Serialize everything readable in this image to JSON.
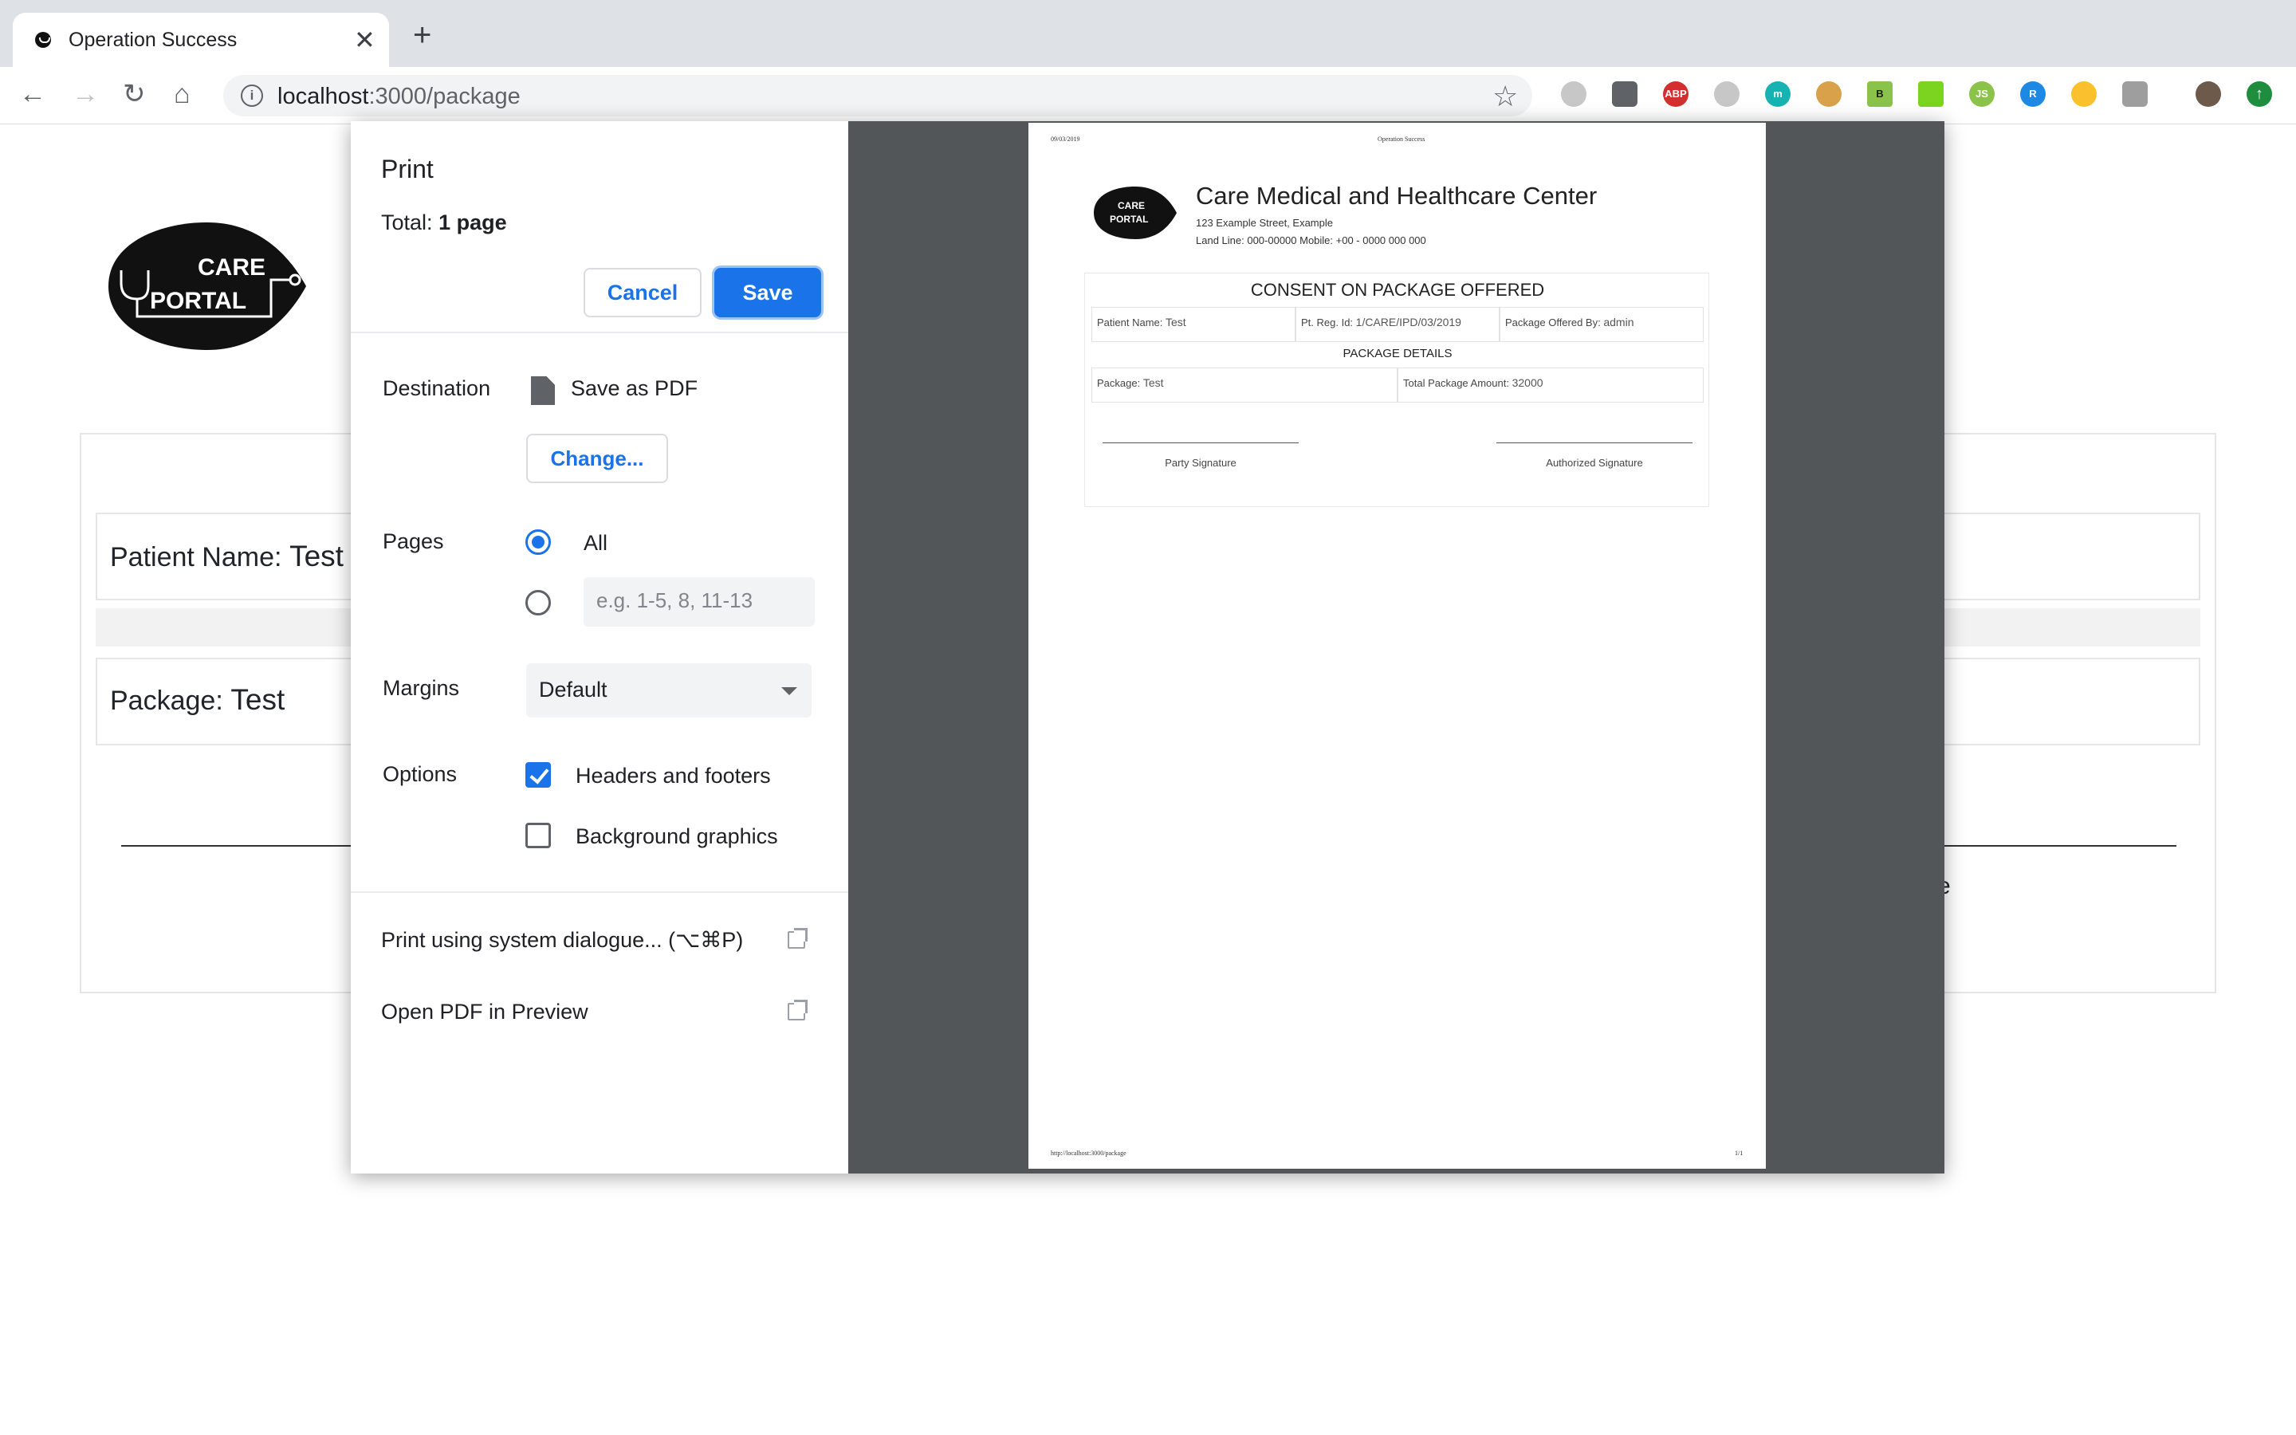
{
  "browser": {
    "tab_title": "Operation Success",
    "tab_close": "✕",
    "new_tab": "+",
    "url_host": "localhost",
    "url_path": ":3000/package",
    "extensions": [
      "ABP",
      "m",
      "B",
      "JS",
      "R"
    ]
  },
  "page": {
    "logo_line1": "CARE",
    "logo_line2": "PORTAL",
    "patient_label": "Patient Name:",
    "patient_value": "Test",
    "package_label": "Package:",
    "package_value": "Test",
    "partial_text": "e"
  },
  "print": {
    "title": "Print",
    "total_label": "Total:",
    "total_value": "1 page",
    "cancel": "Cancel",
    "save": "Save",
    "destination_label": "Destination",
    "destination_value": "Save as PDF",
    "change": "Change...",
    "pages_label": "Pages",
    "pages_all": "All",
    "pages_placeholder": "e.g. 1-5, 8, 11-13",
    "margins_label": "Margins",
    "margins_value": "Default",
    "options_label": "Options",
    "opt_headers": "Headers and footers",
    "opt_headers_checked": true,
    "opt_background": "Background graphics",
    "opt_background_checked": false,
    "system_dialog": "Print using system dialogue... (⌥⌘P)",
    "open_preview": "Open PDF in Preview"
  },
  "preview": {
    "header_date": "09/03/2019",
    "header_title": "Operation Success",
    "footer_url": "http://localhost:3000/package",
    "footer_page": "1/1",
    "logo_line1": "CARE",
    "logo_line2": "PORTAL",
    "center_name": "Care Medical and Healthcare Center",
    "address": "123 Example Street, Example",
    "phone": "Land Line: 000-00000 Mobile: +00 - 0000 000 000",
    "heading": "CONSENT ON PACKAGE OFFERED",
    "patient_label": "Patient Name:",
    "patient_value": "Test",
    "reg_label": "Pt. Reg. Id:",
    "reg_value": "1/CARE/IPD/03/2019",
    "offered_label": "Package Offered By:",
    "offered_value": "admin",
    "details": "PACKAGE DETAILS",
    "package_label": "Package:",
    "package_value": "Test",
    "amount_label": "Total Package Amount:",
    "amount_value": "32000",
    "party_sig": "Party Signature",
    "auth_sig": "Authorized Signature"
  }
}
